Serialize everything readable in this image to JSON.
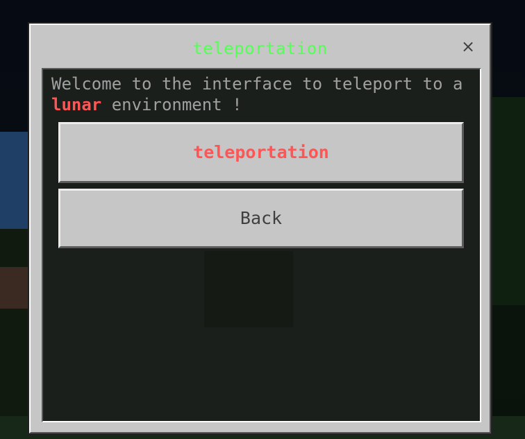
{
  "dialog": {
    "title": "teleportation",
    "close_glyph": "×",
    "welcome_prefix": "Welcome to the interface to teleport to a",
    "welcome_highlight": "lunar",
    "welcome_suffix": "environment !",
    "buttons": {
      "teleport_label": "teleportation",
      "back_label": "Back"
    }
  },
  "colors": {
    "title": "#55ff55",
    "highlight": "#ff5555",
    "panel": "#c6c6c6",
    "content_bg": "#0c100c"
  },
  "icons": {
    "close": "close-icon"
  }
}
